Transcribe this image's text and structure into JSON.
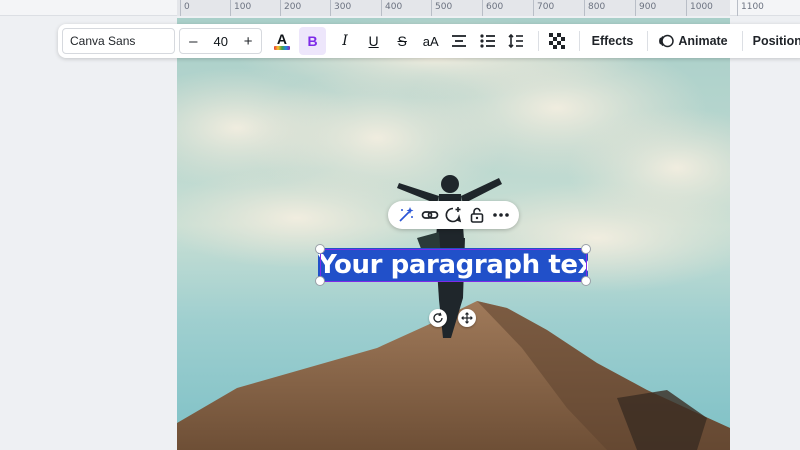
{
  "ruler": {
    "ticks": [
      "0",
      "100",
      "200",
      "300",
      "400",
      "500",
      "600",
      "700",
      "800",
      "900",
      "1000",
      "1100"
    ]
  },
  "toolbar": {
    "font_family": "Canva Sans",
    "font_size": "40",
    "decrease_label": "–",
    "increase_label": "+",
    "color_letter": "A",
    "bold_label": "B",
    "italic_label": "I",
    "underline_label": "U",
    "strike_label": "S",
    "case_label": "aA",
    "effects_label": "Effects",
    "animate_label": "Animate",
    "position_label": "Position"
  },
  "selection": {
    "text": "Your paragraph text"
  },
  "colors": {
    "accent": "#7d2ae8",
    "highlight": "#2150c9",
    "text_color_bar": "#7d2ae8"
  }
}
